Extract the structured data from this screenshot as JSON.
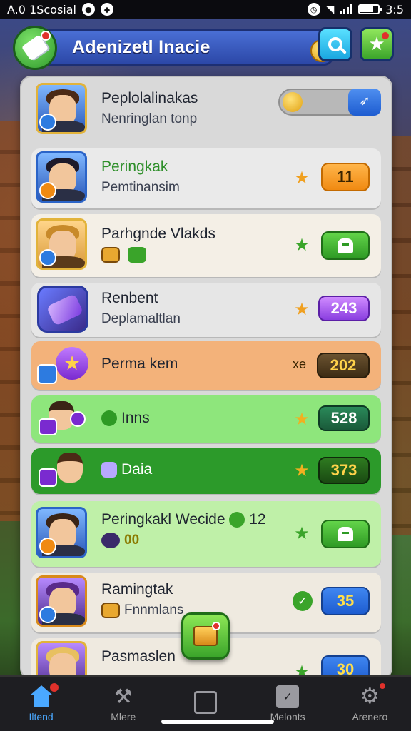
{
  "status_bar": {
    "carrier_text": "A.0 1Scosial",
    "time": "3:5"
  },
  "header": {
    "title": "Adenizetl Inacie"
  },
  "top_row": {
    "name": "Peplolalinakas",
    "subtitle": "Nenringlan tonp"
  },
  "rows": [
    {
      "name": "Peringkak",
      "subtitle": "Pemtinansim",
      "value": "11",
      "name_color": "#2e8f2a",
      "bg": "#eaeaea",
      "pill": "orange"
    },
    {
      "name": "Parhgnde Vlakds",
      "subtitle": "",
      "value": "",
      "bg": "#f4efe6",
      "pill": "green"
    },
    {
      "name": "Renbent",
      "subtitle": "Deplamaltlan",
      "value": "243",
      "bg": "#e6e6e6",
      "pill": "purple"
    },
    {
      "name": "Perma kem",
      "subtitle": "",
      "value": "202",
      "prefix": "xe",
      "bg": "#f3b27a",
      "pill": "dark"
    },
    {
      "name": "Inns",
      "subtitle": "",
      "value": "528",
      "bg": "#8ee67c",
      "pill": "purple"
    },
    {
      "name": "Daia",
      "subtitle": "",
      "value": "373",
      "bg": "#2c9a2a",
      "pill": "dark"
    },
    {
      "name": "Peringkakl Wecide",
      "subtitle": "00",
      "name_suffix": "12",
      "value": "",
      "bg": "#bff0a8",
      "pill": "green"
    },
    {
      "name": "Ramingtak",
      "subtitle": "Fnnmlans",
      "value": "35",
      "bg": "#efeae0",
      "pill": "blue"
    },
    {
      "name": "Pasmaslen",
      "subtitle": "",
      "value": "30",
      "bg": "#efeae0",
      "pill": "blue"
    }
  ],
  "bottom_nav": [
    {
      "label": "Iltend",
      "icon": "home-icon",
      "active": true
    },
    {
      "label": "Mlere",
      "icon": "hammer-icon",
      "active": false
    },
    {
      "label": "",
      "icon": "box-icon",
      "active": false
    },
    {
      "label": "Melonts",
      "icon": "clipboard-icon",
      "active": false
    },
    {
      "label": "Arenero",
      "icon": "gear-icon",
      "active": false
    }
  ],
  "colors": {
    "accent": "#4aa8ff",
    "header_blue": "#2c48a8",
    "green": "#3aa42a"
  }
}
